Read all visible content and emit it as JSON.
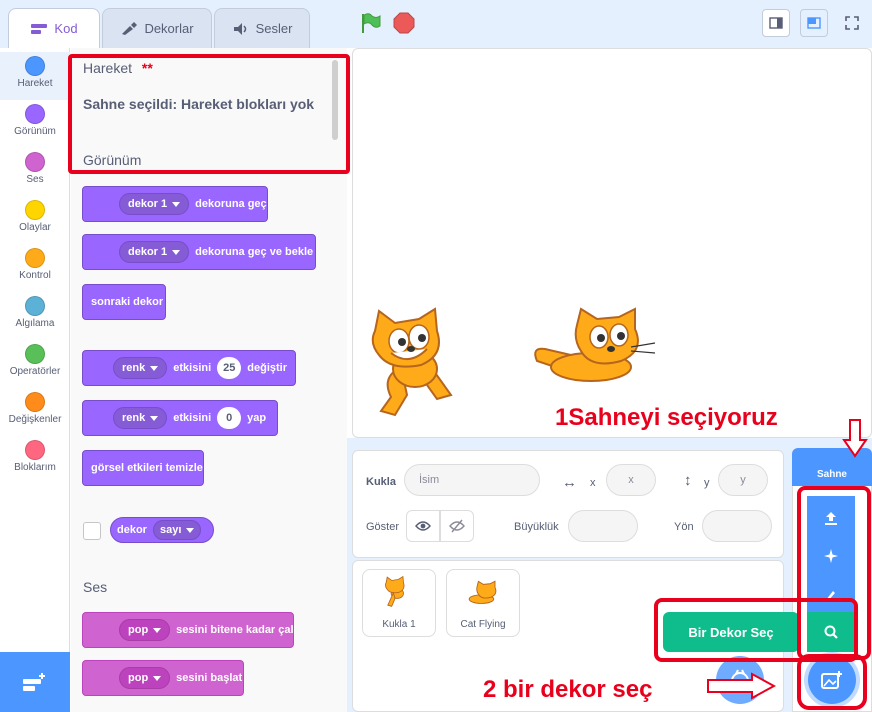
{
  "tabs": {
    "code": "Kod",
    "costumes": "Dekorlar",
    "sounds": "Sesler"
  },
  "categories": [
    {
      "label": "Hareket",
      "color": "#4c97ff"
    },
    {
      "label": "Görünüm",
      "color": "#9966ff"
    },
    {
      "label": "Ses",
      "color": "#cf63cf"
    },
    {
      "label": "Olaylar",
      "color": "#ffd500"
    },
    {
      "label": "Kontrol",
      "color": "#ffab19"
    },
    {
      "label": "Algılama",
      "color": "#5cb1d6"
    },
    {
      "label": "Operatörler",
      "color": "#59c059"
    },
    {
      "label": "Değişkenler",
      "color": "#ff8c1a"
    },
    {
      "label": "Bloklarım",
      "color": "#ff6680"
    }
  ],
  "palette": {
    "motion_title": "Hareket",
    "motion_marker": "**",
    "motion_info": "Sahne seçildi: Hareket blokları yok",
    "looks_title": "Görünüm",
    "sound_title": "Ses",
    "blocks": {
      "switch_backdrop_dd": "dekor 1",
      "switch_backdrop_text": "dekoruna geç",
      "switch_wait_dd": "dekor 1",
      "switch_wait_text": "dekoruna geç ve bekle",
      "next_backdrop": "sonraki dekor",
      "change_effect_dd": "renk",
      "change_effect_text": "etkisini",
      "change_effect_val": "25",
      "change_effect_end": "değiştir",
      "set_effect_dd": "renk",
      "set_effect_text": "etkisini",
      "set_effect_val": "0",
      "set_effect_end": "yap",
      "clear_effects": "görsel etkileri temizle",
      "backdrop_reporter": "dekor",
      "backdrop_reporter_dd": "sayı",
      "play_sound_dd": "pop",
      "play_sound_text": "sesini bitene kadar çal",
      "start_sound_dd": "pop",
      "start_sound_text": "sesini başlat"
    }
  },
  "annotations": {
    "step1": "1Sahneyi seçiyoruz",
    "step2": "2 bir dekor seç"
  },
  "sprite_info": {
    "sprite_label": "Kukla",
    "name_placeholder": "İsim",
    "x_label": "x",
    "x_value": "x",
    "y_label": "y",
    "y_value": "y",
    "show_label": "Göster",
    "size_label": "Büyüklük",
    "direction_label": "Yön"
  },
  "sprites": [
    {
      "name": "Kukla 1"
    },
    {
      "name": "Cat Flying"
    }
  ],
  "stage_selector": {
    "title": "Sahne",
    "tooltip": "Bir Dekor Seç"
  }
}
